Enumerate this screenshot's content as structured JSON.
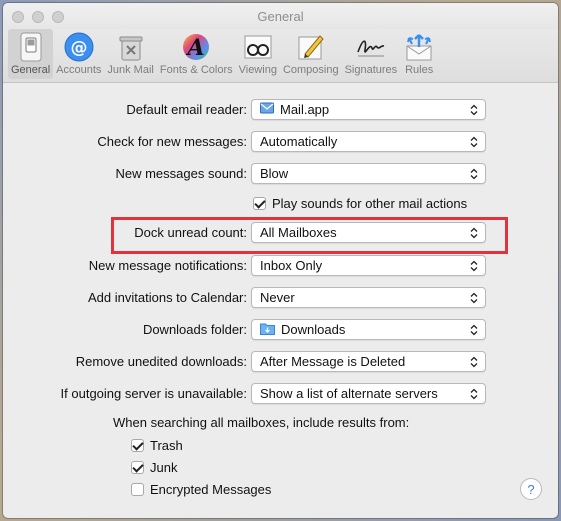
{
  "window": {
    "title": "General"
  },
  "toolbar": {
    "items": [
      {
        "label": "General",
        "icon": "switch-icon",
        "active": true
      },
      {
        "label": "Accounts",
        "icon": "at-sign-icon"
      },
      {
        "label": "Junk Mail",
        "icon": "trash-bin-icon"
      },
      {
        "label": "Fonts & Colors",
        "icon": "font-a-icon"
      },
      {
        "label": "Viewing",
        "icon": "glasses-icon"
      },
      {
        "label": "Composing",
        "icon": "pencil-paper-icon"
      },
      {
        "label": "Signatures",
        "icon": "signature-icon"
      },
      {
        "label": "Rules",
        "icon": "envelope-arrows-icon"
      }
    ]
  },
  "settings": {
    "default_reader": {
      "label": "Default email reader:",
      "value": "Mail.app"
    },
    "check_messages": {
      "label": "Check for new messages:",
      "value": "Automatically"
    },
    "new_sound": {
      "label": "New messages sound:",
      "value": "Blow"
    },
    "play_sounds": {
      "label": "Play sounds for other mail actions",
      "checked": true
    },
    "dock_unread": {
      "label": "Dock unread count:",
      "value": "All Mailboxes"
    },
    "notifications": {
      "label": "New message notifications:",
      "value": "Inbox Only"
    },
    "invitations": {
      "label": "Add invitations to Calendar:",
      "value": "Never"
    },
    "downloads_folder": {
      "label": "Downloads folder:",
      "value": "Downloads"
    },
    "remove_downloads": {
      "label": "Remove unedited downloads:",
      "value": "After Message is Deleted"
    },
    "outgoing_unavailable": {
      "label": "If outgoing server is unavailable:",
      "value": "Show a list of alternate servers"
    }
  },
  "search": {
    "title": "When searching all mailboxes, include results from:",
    "trash": {
      "label": "Trash",
      "checked": true
    },
    "junk": {
      "label": "Junk",
      "checked": true
    },
    "encrypted": {
      "label": "Encrypted Messages",
      "checked": false
    }
  },
  "help": {
    "label": "?"
  },
  "colors": {
    "highlight": "#e2333c",
    "accent": "#3d7de0"
  }
}
